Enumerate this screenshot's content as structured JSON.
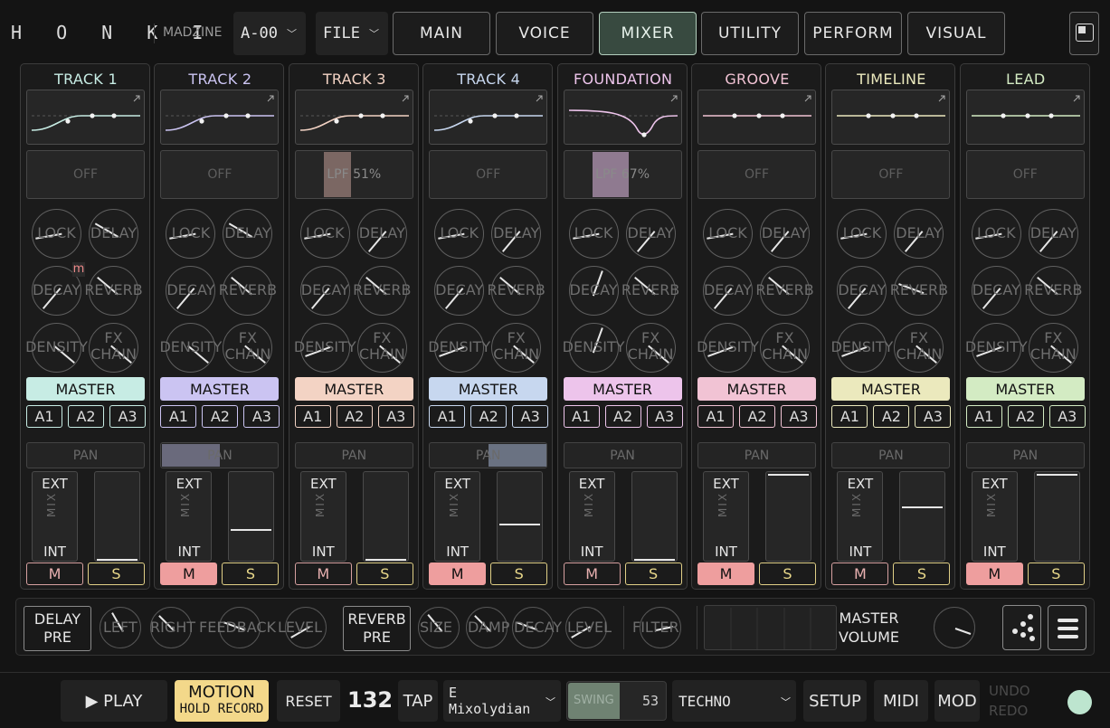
{
  "app": {
    "logo": "H O N K I",
    "module": "MADZINE",
    "preset": "A-00",
    "file_menu": "FILE"
  },
  "tabs": [
    "MAIN",
    "VOICE",
    "MIXER",
    "UTILITY",
    "PERFORM",
    "VISUAL"
  ],
  "active_tab": "MIXER",
  "tracks": [
    {
      "name": "TRACK 1",
      "color": "#c7ece4",
      "filter": "OFF",
      "filter_amount": 0,
      "pan": 0.5,
      "fader": 0.0,
      "mute": false,
      "badge": "m",
      "env": "curve-up"
    },
    {
      "name": "TRACK 2",
      "color": "#cbc4f2",
      "filter": "OFF",
      "filter_amount": 0,
      "pan": 0.5,
      "fader": 0.35,
      "mute": true,
      "env": "curve-up"
    },
    {
      "name": "TRACK 3",
      "color": "#f3d3c4",
      "filter": "LPF 51%",
      "filter_amount": 0.51,
      "pan": 0.5,
      "fader": 0.0,
      "mute": false,
      "env": "curve-up"
    },
    {
      "name": "TRACK 4",
      "color": "#c7d7ef",
      "filter": "OFF",
      "filter_amount": 0,
      "pan": 0.6,
      "fader": 0.42,
      "mute": true,
      "env": "curve-up"
    },
    {
      "name": "FOUNDATION",
      "color": "#edc4eb",
      "filter": "LPF 67%",
      "filter_amount": 0.67,
      "pan": 0.5,
      "fader": 0.0,
      "mute": false,
      "env": "dip"
    },
    {
      "name": "GROOVE",
      "color": "#f1c3d4",
      "filter": "OFF",
      "filter_amount": 0,
      "pan": 0.5,
      "fader": 1.0,
      "mute": true,
      "env": "flat"
    },
    {
      "name": "TIMELINE",
      "color": "#ebe9bd",
      "filter": "OFF",
      "filter_amount": 0,
      "pan": 0.5,
      "fader": 0.62,
      "mute": false,
      "env": "flat"
    },
    {
      "name": "LEAD",
      "color": "#d3ebc3",
      "filter": "OFF",
      "filter_amount": 0,
      "pan": 0.5,
      "fader": 1.0,
      "mute": true,
      "env": "flat"
    }
  ],
  "labels": {
    "lock": "LOCK",
    "delay": "DELAY",
    "decay": "DECAY",
    "reverb": "REVERB",
    "density": "DENSITY",
    "fx1": "FX",
    "fx2": "CHAIN",
    "master": "MASTER",
    "a1": "A1",
    "a2": "A2",
    "a3": "A3",
    "pan": "PAN",
    "ext": "EXT",
    "mix": "MIX",
    "int": "INT",
    "m": "M",
    "s": "S"
  },
  "fx": {
    "delay_pre": [
      "DELAY",
      "PRE"
    ],
    "reverb_pre": [
      "REVERB",
      "PRE"
    ],
    "delay_knobs": [
      "LEFT",
      "RIGHT",
      "FEEDBACK",
      "LEVEL"
    ],
    "reverb_knobs": [
      "SIZE",
      "DAMP",
      "DECAY",
      "LEVEL"
    ],
    "filter": "FILTER",
    "master_volume": [
      "MASTER",
      "VOLUME"
    ]
  },
  "transport": {
    "play": "▶ PLAY",
    "motion": "MOTION",
    "motion_sub": "HOLD RECORD",
    "reset": "RESET",
    "tempo": "132",
    "tap": "TAP",
    "scale_root": "E",
    "scale_mode": "Mixolydian",
    "swing_label": "SWING",
    "swing_value": "53",
    "genre": "TECHNO",
    "setup": "SETUP",
    "midi": "MIDI",
    "mod": "MOD",
    "undo": "UNDO",
    "redo": "REDO"
  },
  "colors": {
    "mute_on": "#ee9e9e",
    "solo": "#e0cf86",
    "motion": "#f3d88a",
    "led": "#bde5cf",
    "active_tab": "#384a40"
  }
}
